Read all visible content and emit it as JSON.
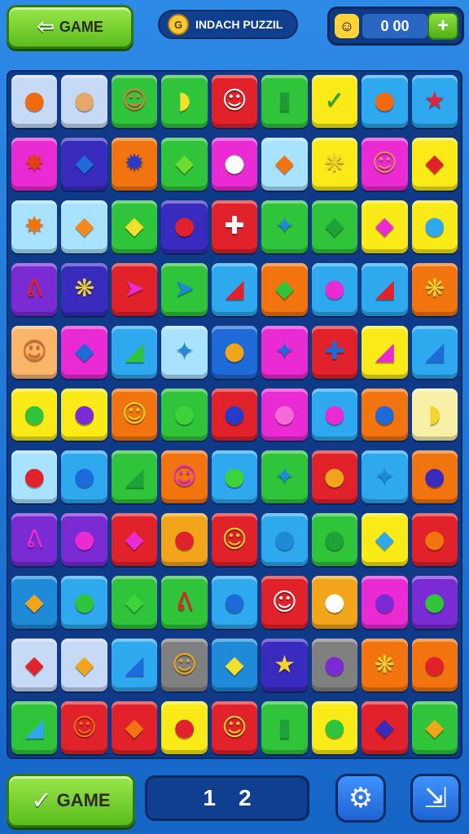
{
  "header": {
    "back_label": "GAME",
    "back_icon": "arrow-left-icon",
    "title": "INDACH PUZZIL",
    "coin_icon": "coin-icon",
    "score": "0 00",
    "avatar_icon": "face-icon",
    "plus_icon": "plus-icon"
  },
  "board": {
    "cols": 9,
    "tiles": [
      [
        "#c6d9f5",
        "#f26a0e",
        "●"
      ],
      [
        "#c6d9f5",
        "#e7a66b",
        "●"
      ],
      [
        "#2fc43a",
        "#e87b3d",
        "☺"
      ],
      [
        "#2fc43a",
        "#f2e02a",
        "◗"
      ],
      [
        "#e2222a",
        "#ffffff",
        "☺"
      ],
      [
        "#2fc43a",
        "#1f9a35",
        "▮"
      ],
      [
        "#f9ea18",
        "#1da62c",
        "✓"
      ],
      [
        "#2ea8ee",
        "#f26a0e",
        "●"
      ],
      [
        "#2ea8ee",
        "#e4243d",
        "★"
      ],
      [
        "#ea2bd3",
        "#e63e13",
        "✸"
      ],
      [
        "#3a2bbf",
        "#1e6ad8",
        "◆"
      ],
      [
        "#f2740f",
        "#263bc8",
        "✹"
      ],
      [
        "#2fc43a",
        "#6ddc2e",
        "◆"
      ],
      [
        "#ea2bd3",
        "#ffffff",
        "●"
      ],
      [
        "#a8e2ff",
        "#f2740f",
        "◆"
      ],
      [
        "#f9ea18",
        "#f2d52a",
        "❋"
      ],
      [
        "#ea2bd3",
        "#f08b5a",
        "☺"
      ],
      [
        "#f9ea18",
        "#e2222a",
        "◆"
      ],
      [
        "#a8e2ff",
        "#f2740f",
        "✸"
      ],
      [
        "#a8e2ff",
        "#f28a1f",
        "◆"
      ],
      [
        "#2fc43a",
        "#f2e02a",
        "◆"
      ],
      [
        "#3a2bbf",
        "#e2222a",
        "●"
      ],
      [
        "#e2222a",
        "#ffffff",
        "✚"
      ],
      [
        "#2fc43a",
        "#1e8ad8",
        "✦"
      ],
      [
        "#2fc43a",
        "#1fa338",
        "◆"
      ],
      [
        "#f9ea18",
        "#ea2bd3",
        "◆"
      ],
      [
        "#f9ea18",
        "#2ea8ee",
        "●"
      ],
      [
        "#7a2bd3",
        "#e2222a",
        "ᕕ"
      ],
      [
        "#3a2bbf",
        "#f2d52a",
        "❋"
      ],
      [
        "#e2222a",
        "#ea2bd3",
        "➤"
      ],
      [
        "#2fc43a",
        "#1e8ad8",
        "➤"
      ],
      [
        "#2ea8ee",
        "#e2222a",
        "◢"
      ],
      [
        "#f2740f",
        "#2fc43a",
        "◆"
      ],
      [
        "#2ea8ee",
        "#ea2bd3",
        "●"
      ],
      [
        "#2ea8ee",
        "#e2222a",
        "◢"
      ],
      [
        "#f2740f",
        "#f2d52a",
        "❋"
      ],
      [
        "#f9b56a",
        "#e0692a",
        "☺"
      ],
      [
        "#ea2bd3",
        "#1e6ad8",
        "◆"
      ],
      [
        "#2ea8ee",
        "#2fc43a",
        "◢"
      ],
      [
        "#a8e2ff",
        "#1e8ad8",
        "✦"
      ],
      [
        "#1e6ad8",
        "#f2a51a",
        "●"
      ],
      [
        "#ea2bd3",
        "#1e6ad8",
        "✦"
      ],
      [
        "#e2222a",
        "#1e6ad8",
        "✚"
      ],
      [
        "#f9ea18",
        "#ea2bd3",
        "◢"
      ],
      [
        "#2ea8ee",
        "#1e6ad8",
        "◢"
      ],
      [
        "#f9ea18",
        "#2fc43a",
        "●"
      ],
      [
        "#f9ea18",
        "#7a2bd3",
        "●"
      ],
      [
        "#f2740f",
        "#f2d52a",
        "☺"
      ],
      [
        "#2fc43a",
        "#3fd33a",
        "●"
      ],
      [
        "#e2222a",
        "#263bc8",
        "●"
      ],
      [
        "#ea2bd3",
        "#f46ad8",
        "●"
      ],
      [
        "#2ea8ee",
        "#ea2bd3",
        "●"
      ],
      [
        "#f2740f",
        "#1e6ad8",
        "●"
      ],
      [
        "#f9f0a8",
        "#f2d52a",
        "◗"
      ],
      [
        "#a8e2ff",
        "#e2222a",
        "●"
      ],
      [
        "#2ea8ee",
        "#1e6ad8",
        "●"
      ],
      [
        "#2fc43a",
        "#1fa338",
        "◢"
      ],
      [
        "#f2740f",
        "#ea2bd3",
        "☺"
      ],
      [
        "#2ea8ee",
        "#3fd33a",
        "●"
      ],
      [
        "#2fc43a",
        "#1e8ad8",
        "✦"
      ],
      [
        "#e2222a",
        "#f2a51a",
        "●"
      ],
      [
        "#2ea8ee",
        "#1e8ad8",
        "✦"
      ],
      [
        "#f2740f",
        "#3a2bbf",
        "●"
      ],
      [
        "#7a2bd3",
        "#ea2bd3",
        "ᕕ"
      ],
      [
        "#7a2bd3",
        "#ea2bd3",
        "●"
      ],
      [
        "#e2222a",
        "#ea2bd3",
        "◆"
      ],
      [
        "#f2a51a",
        "#e2222a",
        "●"
      ],
      [
        "#e2222a",
        "#f2d52a",
        "☺"
      ],
      [
        "#2ea8ee",
        "#1e8ad8",
        "●"
      ],
      [
        "#2fc43a",
        "#1fa338",
        "●"
      ],
      [
        "#f9ea18",
        "#2ea8ee",
        "◆"
      ],
      [
        "#e2222a",
        "#f2740f",
        "●"
      ],
      [
        "#1e8ad8",
        "#f2a51a",
        "◆"
      ],
      [
        "#2ea8ee",
        "#2fc43a",
        "●"
      ],
      [
        "#2fc43a",
        "#3fd33a",
        "◆"
      ],
      [
        "#2fc43a",
        "#e2222a",
        "ᕕ"
      ],
      [
        "#2ea8ee",
        "#1e6ad8",
        "●"
      ],
      [
        "#e2222a",
        "#ffffff",
        "☺"
      ],
      [
        "#f2a51a",
        "#ffffff",
        "●"
      ],
      [
        "#ea2bd3",
        "#7a2bd3",
        "●"
      ],
      [
        "#7a2bd3",
        "#2fc43a",
        "●"
      ],
      [
        "#c6d9f5",
        "#e2222a",
        "◆"
      ],
      [
        "#c6d9f5",
        "#f2a51a",
        "◆"
      ],
      [
        "#2ea8ee",
        "#1e6ad8",
        "◢"
      ],
      [
        "#808080",
        "#f2a51a",
        "☺"
      ],
      [
        "#1e8ad8",
        "#f2e02a",
        "◆"
      ],
      [
        "#3a2bbf",
        "#f2d52a",
        "★"
      ],
      [
        "#808080",
        "#7a2bd3",
        "●"
      ],
      [
        "#f2740f",
        "#f2d52a",
        "❋"
      ],
      [
        "#f2740f",
        "#e2222a",
        "●"
      ],
      [
        "#2fc43a",
        "#2ea8ee",
        "◢"
      ],
      [
        "#e2222a",
        "#f2740f",
        "☺"
      ],
      [
        "#e2222a",
        "#f2740f",
        "◆"
      ],
      [
        "#f9ea18",
        "#e2222a",
        "●"
      ],
      [
        "#e2222a",
        "#f2d52a",
        "☺"
      ],
      [
        "#2fc43a",
        "#1fa338",
        "▮"
      ],
      [
        "#f9ea18",
        "#2fc43a",
        "●"
      ],
      [
        "#e2222a",
        "#3a2bbf",
        "◆"
      ],
      [
        "#2fc43a",
        "#f2a51a",
        "◆"
      ]
    ]
  },
  "footer": {
    "game_label": "GAME",
    "check_icon": "check-icon",
    "page_current": "1",
    "page_total": "2",
    "settings_icon": "gear-icon",
    "exit_icon": "exit-icon"
  }
}
